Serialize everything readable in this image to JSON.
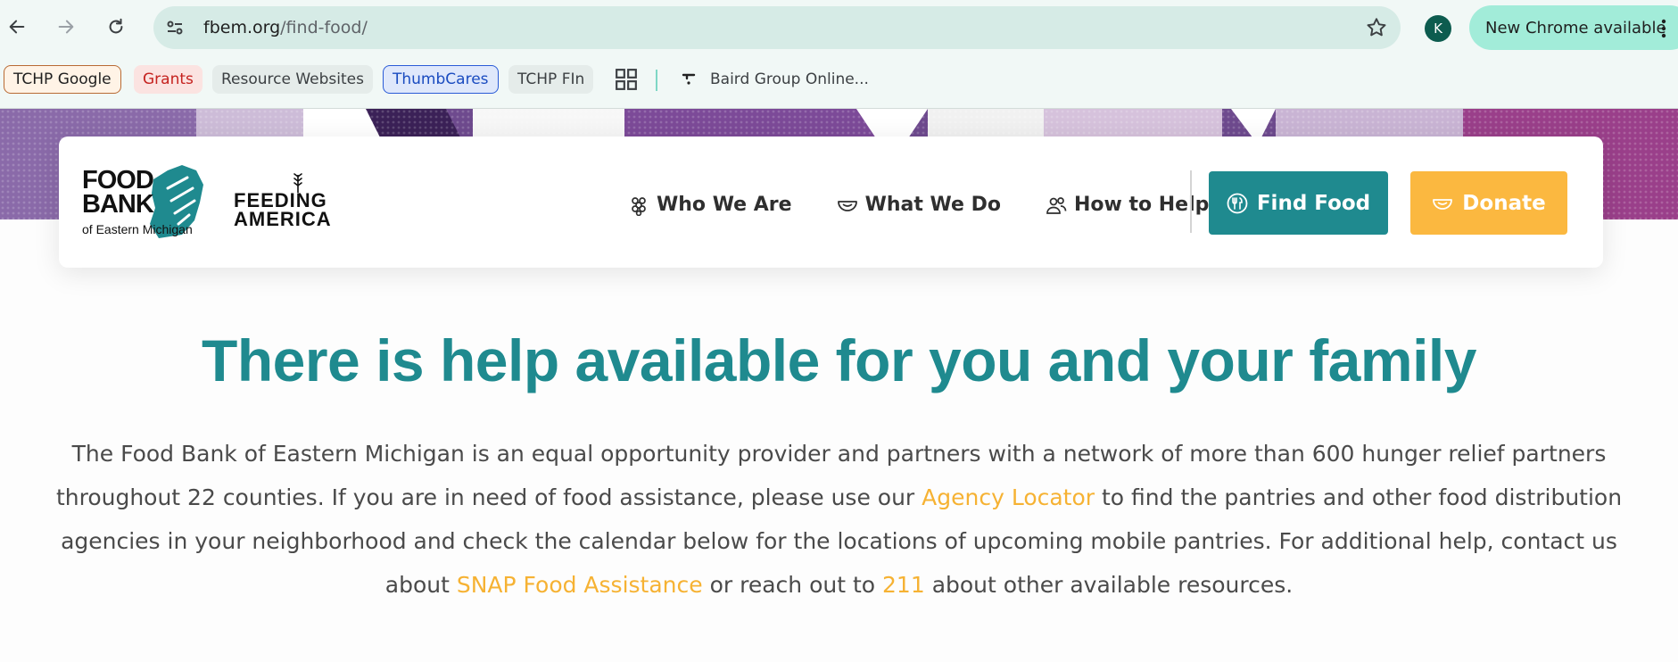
{
  "browser": {
    "url_domain": "fbem.org",
    "url_path": "/find-food/",
    "profile_initial": "K",
    "update_label": "New Chrome available"
  },
  "bookmarks": {
    "items": [
      {
        "label": "TCHP Google"
      },
      {
        "label": "Grants"
      },
      {
        "label": "Resource Websites"
      },
      {
        "label": "ThumbCares"
      },
      {
        "label": "TCHP FIn"
      },
      {
        "label": "Baird Group Online..."
      }
    ]
  },
  "header": {
    "logo_fbem_line1": "FOOD",
    "logo_fbem_line2": "BANK",
    "logo_fbem_sub": "of Eastern Michigan",
    "logo_fa_line1": "FEEDING",
    "logo_fa_line2": "AMERICA",
    "nav": [
      {
        "label": "Who We Are",
        "icon": "grapes-icon"
      },
      {
        "label": "What We Do",
        "icon": "bowl-icon"
      },
      {
        "label": "How to Help",
        "icon": "people-icon"
      }
    ],
    "find_food_label": "Find Food",
    "donate_label": "Donate"
  },
  "main": {
    "heading": "There is help available for you and your family",
    "intro_part1": "The Food Bank of Eastern Michigan is an equal opportunity provider and partners with a network of more than 600 hunger relief partners throughout 22 counties. If you are in need of food assistance, please use our ",
    "link_agency": "Agency Locator",
    "intro_part2": " to find the pantries and other food distribution agencies in your neighborhood and check the calendar below for the locations of upcoming mobile pantries. For additional help, contact us about ",
    "link_snap": "SNAP Food Assistance",
    "intro_part3": " or reach out to ",
    "link_211": "211",
    "intro_part4": " about other available resources."
  },
  "colors": {
    "brand_teal": "#1f8a8f",
    "brand_yellow": "#fbb840",
    "link_orange": "#f6b233",
    "hero_purple": "#7a4f96"
  }
}
